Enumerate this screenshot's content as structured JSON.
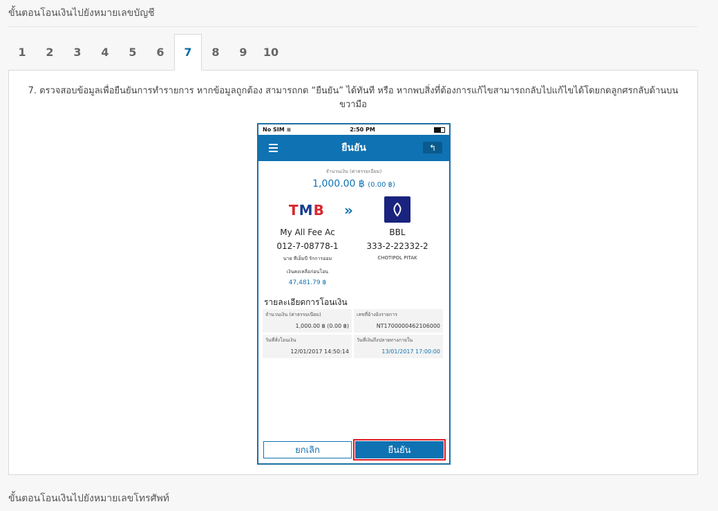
{
  "section1_title": "ขั้นตอนโอนเงินไปยังหมายเลขบัญชี",
  "section2_title": "ขั้นตอนโอนเงินไปยังหมายเลขโทรศัพท์",
  "tabs": [
    "1",
    "2",
    "3",
    "4",
    "5",
    "6",
    "7",
    "8",
    "9",
    "10"
  ],
  "active_tab": "7",
  "step_description": "7. ตรวจสอบข้อมูลเพื่อยืนยันการทำรายการ หากข้อมูลถูกต้อง สามารถกด “ยืนยัน” ได้ทันที หรือ หากพบสิ่งที่ต้องการแก้ไขสามารถกลับไปแก้ไขได้โดยกดลูกศรกลับด้านบนขวามือ",
  "phone": {
    "status_carrier": "No SIM",
    "status_time": "2:50 PM",
    "title": "ยืนยัน",
    "amount_label": "จำนวนเงิน (ค่าธรรมเนียม)",
    "amount": "1,000.00 ฿",
    "fee": "(0.00 ฿)",
    "from_bank_logo": "TMB",
    "transfer_arrow": "»",
    "from_name": "My All Fee Ac",
    "from_number": "012-7-08778-1",
    "from_owner": "นาย ทีเอ็มบี รักการออม",
    "balance_label": "เงินคงเหลือก่อนโอน",
    "balance": "47,481.79 ฿",
    "to_name": "BBL",
    "to_number": "333-2-22332-2",
    "to_owner": "CHOTIPOL PITAK",
    "details_title": "รายละเอียดการโอนเงิน",
    "d_amount_label": "จำนวนเงิน (ค่าธรรมเนียม)",
    "d_amount": "1,000.00 ฿ (0.00 ฿)",
    "d_ref_label": "เลขที่อ้างอิงรายการ",
    "d_ref": "NT1700000462106000",
    "d_order_label": "วันที่สั่งโอนเงิน",
    "d_order": "12/01/2017 14:50:14",
    "d_arrive_label": "วันที่เงินถึงปลายทางภายใน",
    "d_arrive": "13/01/2017 17:00:00",
    "cancel": "ยกเลิก",
    "confirm": "ยืนยัน"
  },
  "colors": {
    "accent": "#0f72b2",
    "highlight": "#e01b24",
    "tmb_red": "#d7282f",
    "bbl_navy": "#1a237e"
  },
  "icons": [
    "menu-icon",
    "back-arrow-icon",
    "wifi-icon",
    "battery-icon",
    "bbl-lotus-icon"
  ]
}
